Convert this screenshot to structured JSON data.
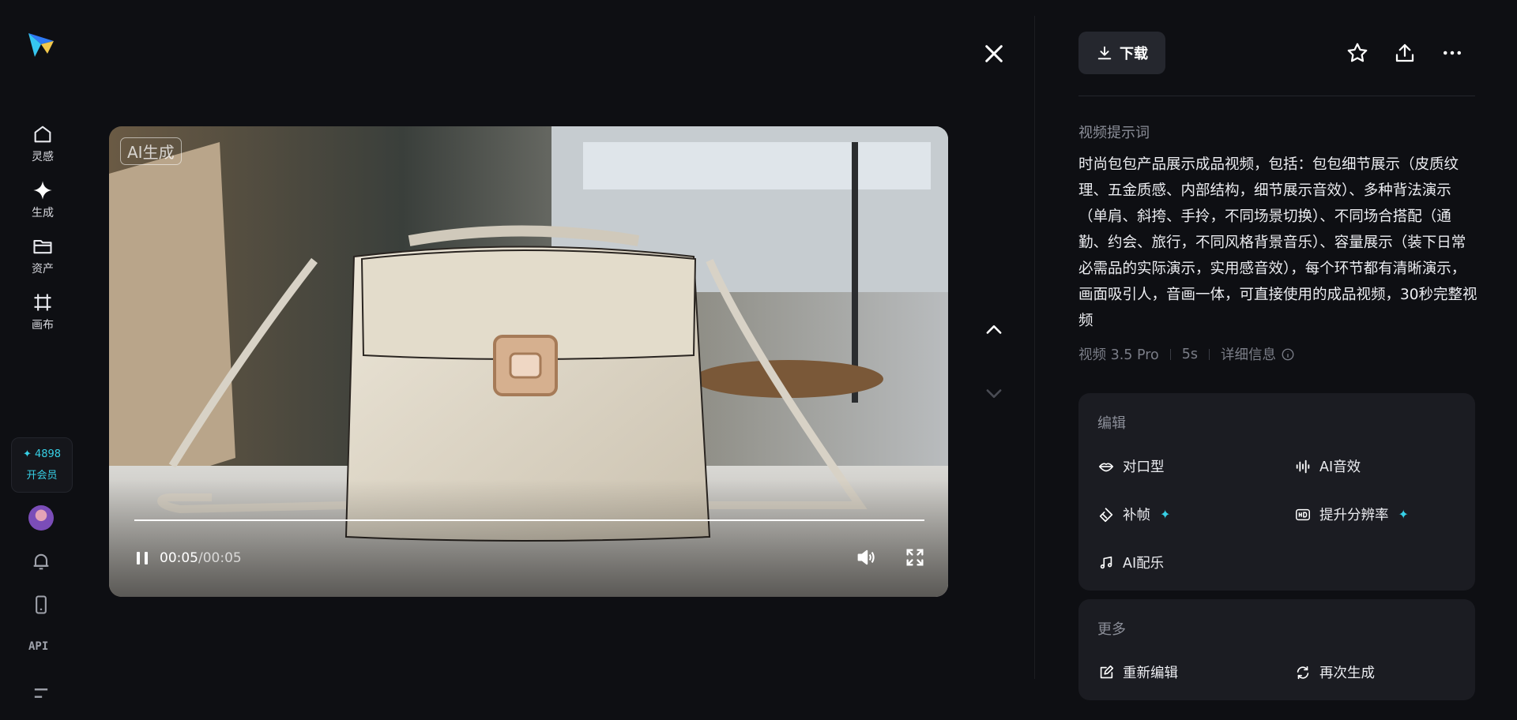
{
  "nav": {
    "items": [
      {
        "label": "灵感",
        "icon": "home-icon"
      },
      {
        "label": "生成",
        "icon": "sparkle-icon"
      },
      {
        "label": "资产",
        "icon": "folder-icon"
      },
      {
        "label": "画布",
        "icon": "canvas-icon"
      }
    ],
    "credits": "✦ 4898",
    "vip_label": "开会员",
    "api_label": "API"
  },
  "player": {
    "badge": "AI生成",
    "time_current": "00:05",
    "time_separator": "/",
    "time_total": "00:05",
    "progress": 1.0
  },
  "panel": {
    "download_label": "下载",
    "prompt_title": "视频提示词",
    "prompt_text": "时尚包包产品展示成品视频，包括：包包细节展示（皮质纹理、五金质感、内部结构，细节展示音效）、多种背法演示（单肩、斜挎、手拎，不同场景切换）、不同场合搭配（通勤、约会、旅行，不同风格背景音乐）、容量展示（装下日常必需品的实际演示，实用感音效），每个环节都有清晰演示，画面吸引人，音画一体，可直接使用的成品视频，30秒完整视频",
    "model": "视频 3.5 Pro",
    "duration": "5s",
    "details_label": "详细信息"
  },
  "edit_card": {
    "title": "编辑",
    "options": [
      {
        "label": "对口型",
        "icon": "lips-icon",
        "premium": false
      },
      {
        "label": "AI音效",
        "icon": "sound-wave-icon",
        "premium": false
      },
      {
        "label": "补帧",
        "icon": "diamond-frames-icon",
        "premium": true
      },
      {
        "label": "提升分辨率",
        "icon": "hd-icon",
        "premium": true
      },
      {
        "label": "AI配乐",
        "icon": "music-note-icon",
        "premium": false
      }
    ]
  },
  "more_card": {
    "title": "更多",
    "options": [
      {
        "label": "重新编辑",
        "icon": "edit-icon"
      },
      {
        "label": "再次生成",
        "icon": "regenerate-icon"
      }
    ]
  },
  "colors": {
    "background": "#0e0f13",
    "card": "#1b1c22",
    "accent": "#37d0e6"
  }
}
